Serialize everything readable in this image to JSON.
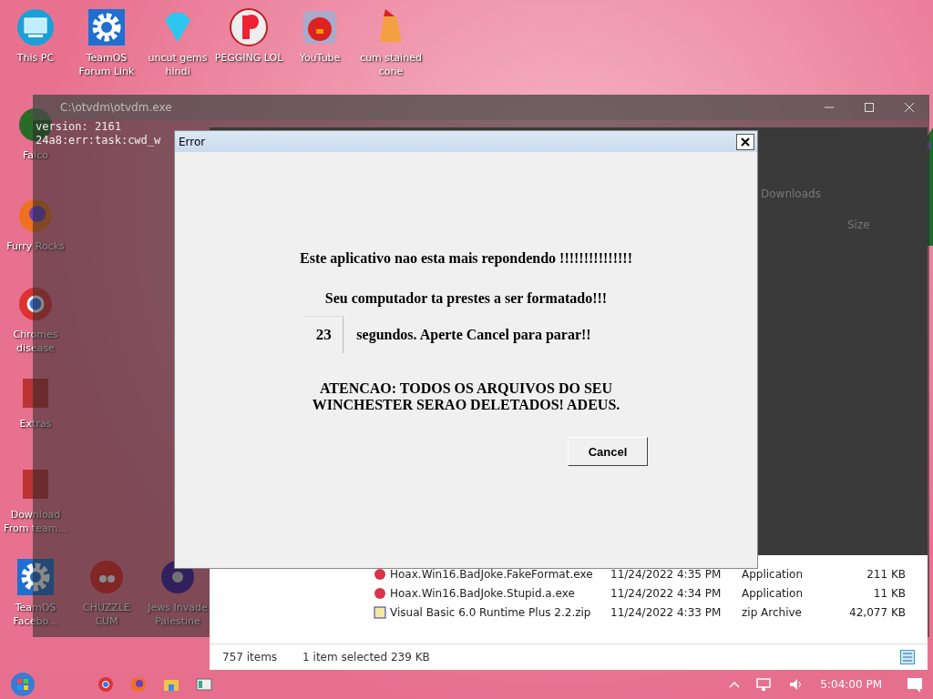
{
  "desktop_icons": [
    {
      "label": "This PC",
      "kind": "monitor"
    },
    {
      "label": "TeamOS Forum Link",
      "kind": "gear"
    },
    {
      "label": "uncut gems hindi",
      "kind": "gem"
    },
    {
      "label": "PEGGING LOL",
      "kind": "letter"
    },
    {
      "label": "YouTube",
      "kind": "bird"
    },
    {
      "label": "cum stained cone",
      "kind": "cone"
    },
    {
      "label": "Falco",
      "kind": "globe"
    },
    {
      "label": "Furry Rocks",
      "kind": "fox"
    },
    {
      "label": "Chromes disease",
      "kind": "chrome"
    },
    {
      "label": "Extras",
      "kind": "box"
    },
    {
      "label": "Download From team...",
      "kind": "box"
    },
    {
      "label": "TeamOS Facebo...",
      "kind": "gear"
    },
    {
      "label": "CHUZZLE CUM",
      "kind": "fuzz"
    },
    {
      "label": "Jews Invade Palestine",
      "kind": "orb"
    }
  ],
  "console": {
    "title": "C:\\otvdm\\otvdm.exe",
    "lines": [
      "version: 2161",
      "24a8:err:task:cwd_w"
    ]
  },
  "explorer": {
    "location": "Downloads",
    "size_header": "Size",
    "rows": [
      {
        "name": "Hoax.Win16.BadJoke.FakeFormat.exe",
        "date": "11/24/2022 4:35 PM",
        "type": "Application",
        "size": "211 KB",
        "kind": "app"
      },
      {
        "name": "Hoax.Win16.BadJoke.Stupid.a.exe",
        "date": "11/24/2022 4:34 PM",
        "type": "Application",
        "size": "11 KB",
        "kind": "app"
      },
      {
        "name": "Visual Basic 6.0 Runtime Plus 2.2.zip",
        "date": "11/24/2022 4:33 PM",
        "type": "zip Archive",
        "size": "42,077 KB",
        "kind": "zip"
      }
    ],
    "status_count": "757 items",
    "status_selection": "1 item selected  239 KB"
  },
  "dialog": {
    "title": "Error",
    "message": "Este aplicativo nao esta mais repondendo !!!!!!!!!!!!!!!",
    "warning": "Seu computador ta prestes a ser formatado!!!",
    "countdown": "23",
    "countdown_text": "segundos. Aperte Cancel para parar!!",
    "alert": "ATENCAO:  TODOS OS ARQUIVOS DO SEU WINCHESTER SERAO DELETADOS! ADEUS.",
    "cancel": "Cancel"
  },
  "taskbar": {
    "apps": [
      {
        "kind": "chrome"
      },
      {
        "kind": "firefox"
      },
      {
        "kind": "folder"
      },
      {
        "kind": "window"
      }
    ],
    "clock": "5:04:00 PM"
  }
}
